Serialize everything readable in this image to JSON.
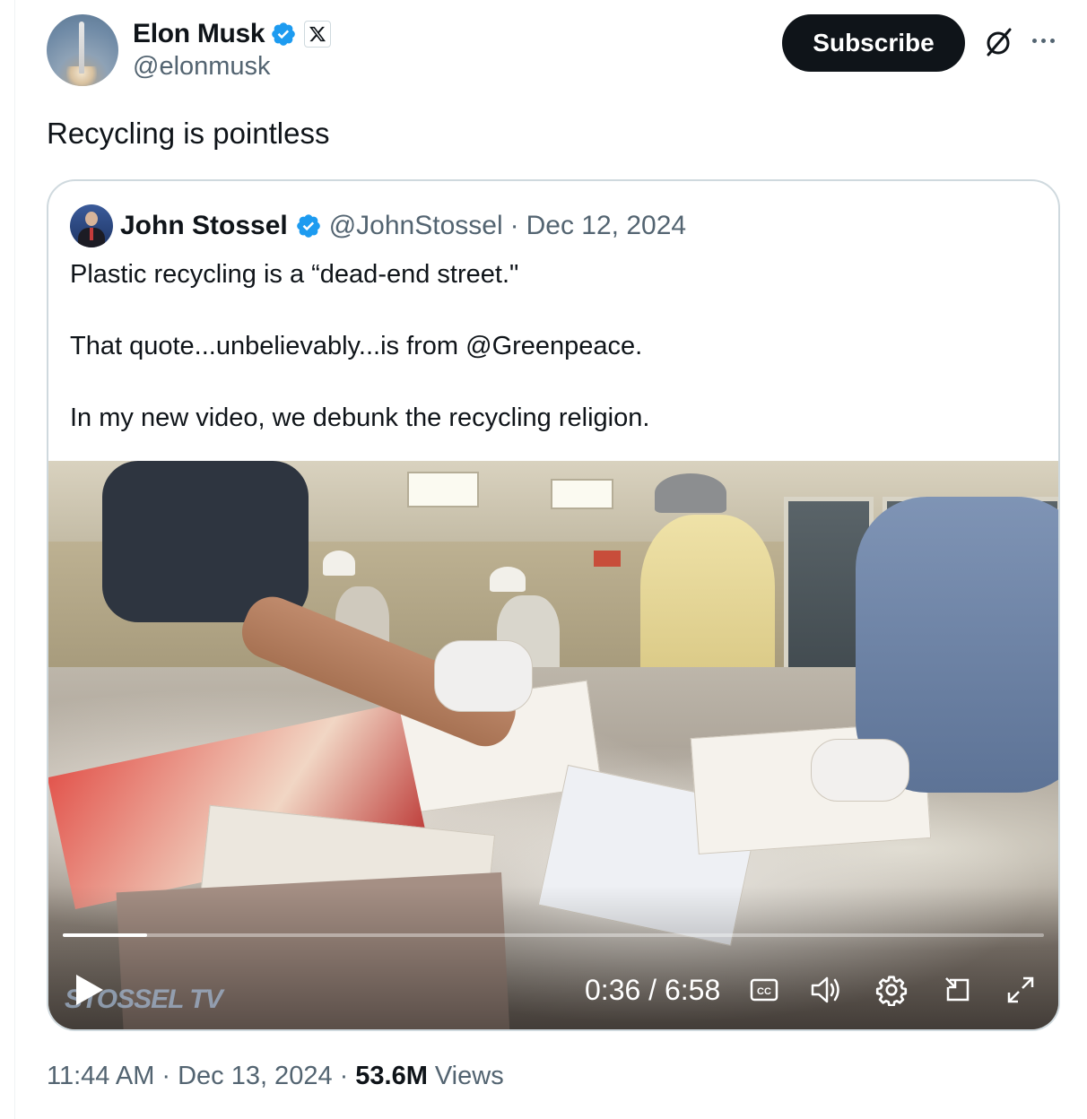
{
  "author": {
    "display_name": "Elon Musk",
    "handle": "@elonmusk",
    "verified": true,
    "affiliate_badge_icon": "x-logo-icon"
  },
  "actions": {
    "subscribe_label": "Subscribe",
    "grok_icon": "slashed-circle-icon",
    "more_icon": "more-horizontal-icon"
  },
  "tweet": {
    "text": "Recycling is pointless"
  },
  "quoted": {
    "display_name": "John Stossel",
    "handle": "@JohnStossel",
    "separator": "·",
    "date": "Dec 12, 2024",
    "verified": true,
    "paragraphs": [
      "Plastic recycling is a “dead-end street.\"",
      "That quote...unbelievably...is from @Greenpeace.",
      "In my new video, we debunk the recycling religion."
    ]
  },
  "video": {
    "current_time": "0:36",
    "duration": "6:58",
    "time_display": "0:36 / 6:58",
    "progress_fraction": 0.086,
    "watermark": "STOSSEL TV",
    "controls": [
      "play-icon",
      "closed-captions-icon",
      "volume-icon",
      "settings-gear-icon",
      "picture-in-picture-icon",
      "fullscreen-icon"
    ]
  },
  "footer": {
    "time": "11:44 AM",
    "separator": "·",
    "date": "Dec 13, 2024",
    "views_count": "53.6M",
    "views_label": "Views"
  },
  "colors": {
    "verified_blue": "#1d9bf0",
    "text_primary": "#0f1419",
    "text_secondary": "#536471",
    "border": "#cfd9de"
  }
}
